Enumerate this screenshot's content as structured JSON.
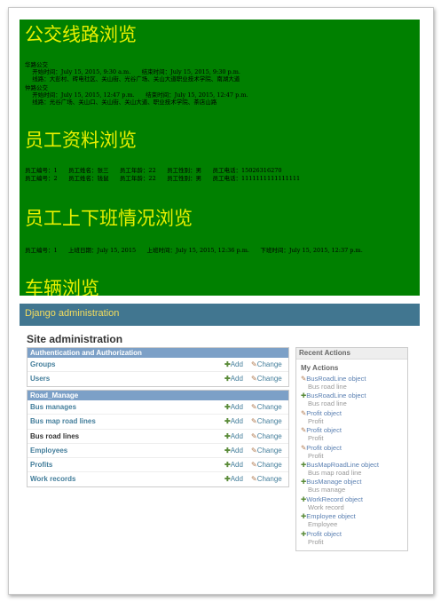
{
  "green": {
    "sections": [
      {
        "title": "公交线路浏览"
      },
      {
        "title": "员工资料浏览"
      },
      {
        "title": "员工上下班情况浏览"
      },
      {
        "title": "车辆浏览"
      }
    ],
    "bus_lines": [
      {
        "name": "华路公交",
        "time": "    开始时间：July 15, 2015, 9:30 a.m.      结束时间：July 15, 2015, 9:30 p.m.",
        "route": "    线路：大彭村、砖电社区、关山街、光谷广场、关山大道职业技术学院、南湖大道"
      },
      {
        "name": "仲路公交",
        "time": "    开始时间：July 15, 2015, 12:47 p.m.      结束时间：July 15, 2015, 12:47 p.m.",
        "route": "    线路：光谷广场、关山口、关山街、关山大道、职业技术学院、茶店山路"
      }
    ],
    "employees": [
      "员工编号：1      员工姓名：张三      员工年龄：22      员工性别：男      员工电话：15026316270",
      "员工编号：2      员工姓名：钱鼠      员工年龄：22      员工性别：男      员工电话：1111111111111111"
    ],
    "work_records": [
      "员工编号：1      上班日期：July 15, 2015      上班时间：July 15, 2015, 12:36 p.m.      下班时间：July 15, 2015, 12:37 p.m."
    ]
  },
  "django": {
    "header": "Django administration",
    "site_title": "Site administration",
    "add_label": "Add",
    "change_label": "Change",
    "modules": [
      {
        "caption": "Authentication and Authorization",
        "models": [
          "Groups",
          "Users"
        ]
      },
      {
        "caption": "Road_Manage",
        "models": [
          "Bus manages",
          "Bus map road lines",
          "Bus road lines",
          "Employees",
          "Profits",
          "Work records"
        ]
      }
    ],
    "recent_actions": {
      "caption": "Recent Actions",
      "subtitle": "My Actions",
      "items": [
        {
          "icon": "pencil-icon",
          "name": "BusRoadLine object",
          "type": "Bus road line"
        },
        {
          "icon": "plus-icon",
          "name": "BusRoadLine object",
          "type": "Bus road line"
        },
        {
          "icon": "pencil-icon",
          "name": "Profit object",
          "type": "Profit"
        },
        {
          "icon": "pencil-icon",
          "name": "Profit object",
          "type": "Profit"
        },
        {
          "icon": "pencil-icon",
          "name": "Profit object",
          "type": "Profit"
        },
        {
          "icon": "plus-icon",
          "name": "BusMapRoadLine object",
          "type": "Bus map road line"
        },
        {
          "icon": "plus-icon",
          "name": "BusManage object",
          "type": "Bus manage"
        },
        {
          "icon": "plus-icon",
          "name": "WorkRecord object",
          "type": "Work record"
        },
        {
          "icon": "plus-icon",
          "name": "Employee object",
          "type": "Employee"
        },
        {
          "icon": "plus-icon",
          "name": "Profit object",
          "type": "Profit"
        }
      ]
    },
    "colors": {
      "header_bg": "#417690",
      "header_text": "#f5dd5d",
      "green_bg": "#008000",
      "heading_yellow": "#e8f000",
      "module_caption": "#7ca0c7"
    }
  }
}
